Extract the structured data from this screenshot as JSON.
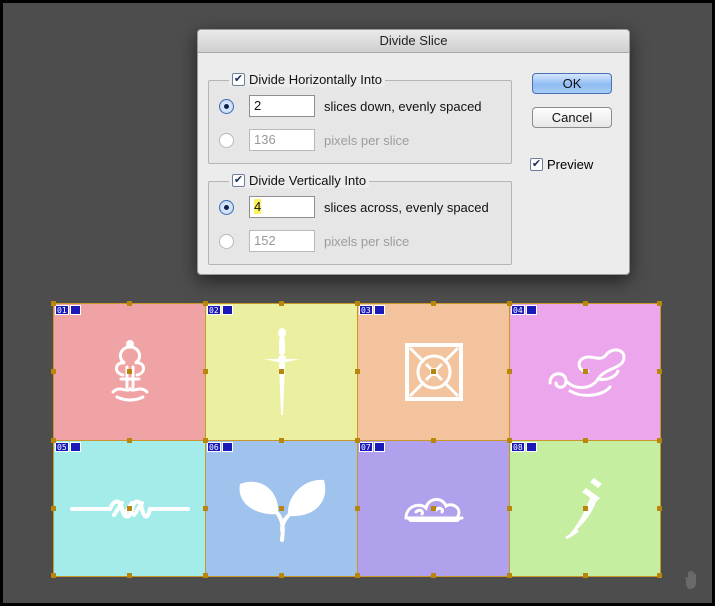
{
  "dialog": {
    "title": "Divide Slice",
    "horizontal": {
      "label": "Divide Horizontally Into",
      "checked": true,
      "slices_value": "2",
      "slices_label": "slices down, evenly spaced",
      "pixels_value": "136",
      "pixels_label": "pixels per slice"
    },
    "vertical": {
      "label": "Divide Vertically Into",
      "checked": true,
      "slices_value": "4",
      "slices_label": "slices across, evenly spaced",
      "pixels_value": "152",
      "pixels_label": "pixels per slice"
    },
    "ok_label": "OK",
    "cancel_label": "Cancel",
    "preview_label": "Preview",
    "preview_checked": true
  },
  "slices": [
    {
      "num": "01",
      "color": "#f0a3a5",
      "icon": "fleur-ornament-icon"
    },
    {
      "num": "02",
      "color": "#ebf0a0",
      "icon": "dagger-cross-icon"
    },
    {
      "num": "03",
      "color": "#f2c39d",
      "icon": "celtic-square-icon"
    },
    {
      "num": "04",
      "color": "#eca6ec",
      "icon": "swirl-flourish-icon"
    },
    {
      "num": "05",
      "color": "#a3ecea",
      "icon": "rope-divider-icon"
    },
    {
      "num": "06",
      "color": "#9fc3ed",
      "icon": "leaves-icon"
    },
    {
      "num": "07",
      "color": "#b1a0ec",
      "icon": "cloud-scroll-icon"
    },
    {
      "num": "08",
      "color": "#c6eea1",
      "icon": "sword-icon"
    }
  ]
}
